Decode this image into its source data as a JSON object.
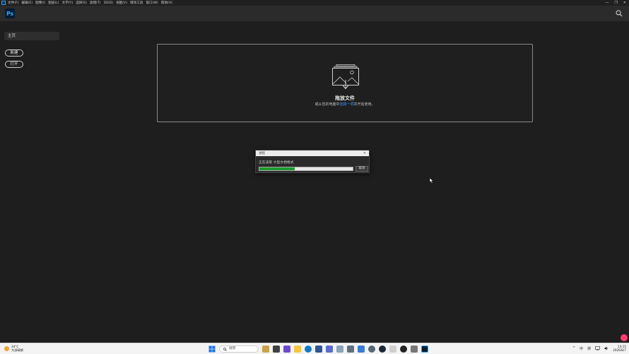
{
  "menubar": {
    "app_icon": "Ps",
    "items": [
      "文件(F)",
      "编辑(E)",
      "图像(I)",
      "图层(L)",
      "文字(Y)",
      "选择(S)",
      "滤镜(T)",
      "3D(D)",
      "视图(V)",
      "增效工具",
      "窗口(W)",
      "帮助(H)"
    ],
    "window_controls": [
      "—",
      "❐",
      "✕"
    ]
  },
  "header": {
    "logo": "Ps",
    "search_icon": "search-icon"
  },
  "sidebar": {
    "home_label": "主页",
    "new_button": "新建",
    "open_button": "打开"
  },
  "dropzone": {
    "title": "拖放文件",
    "subtitle_prefix": "或从您的电脑中",
    "subtitle_link": "选择一项",
    "subtitle_suffix": "并开始使用。"
  },
  "progress_dialog": {
    "title": "进程",
    "close": "✕",
    "status": "正在读取 大型文档格式",
    "progress": 0.38,
    "cancel_label": "取消"
  },
  "taskbar": {
    "weather_temp": "34°C",
    "weather_desc": "大部晴朗",
    "search_placeholder": "搜索",
    "tray_chevron": "^",
    "ime_lang": "中",
    "ime_mode": "拼",
    "time": "13:15",
    "date": "2026/6/7"
  },
  "colors": {
    "accent_blue": "#31a8ff",
    "progress_green": "#1e9b2e",
    "cc_pink": "#ff3e70"
  }
}
